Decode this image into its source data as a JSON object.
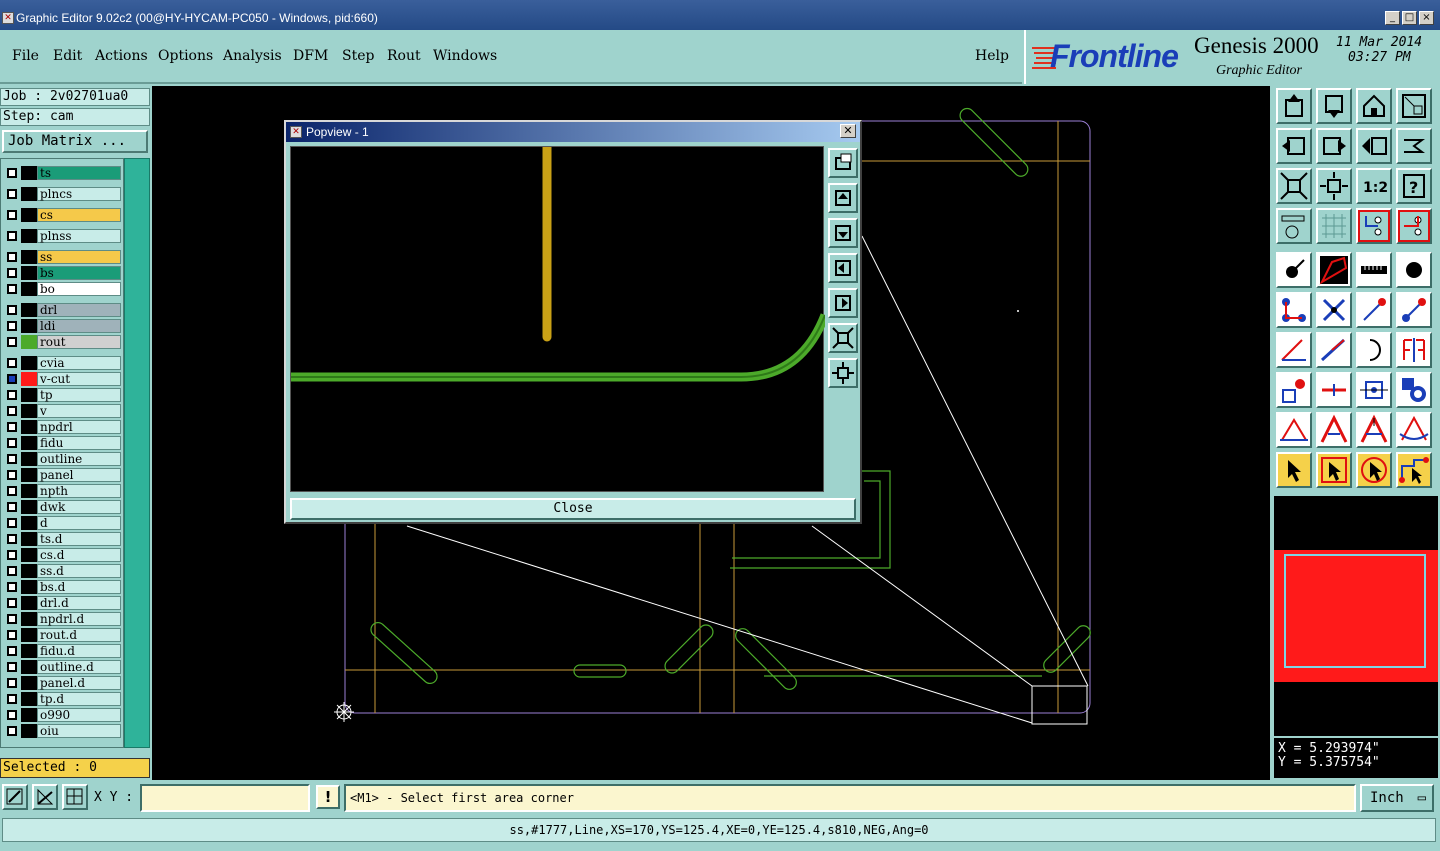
{
  "window": {
    "title": "Graphic Editor 9.02c2 (00@HY-HYCAM-PC050 - Windows, pid:660)",
    "controls": [
      "_",
      "□",
      "×"
    ]
  },
  "menu": [
    "File",
    "Edit",
    "Actions",
    "Options",
    "Analysis",
    "DFM",
    "Step",
    "Rout",
    "Windows"
  ],
  "help": "Help",
  "brand": {
    "logo": "Frontline",
    "product": "Genesis 2000",
    "subtitle": "Graphic Editor",
    "date": "11 Mar 2014",
    "time": "03:27 PM"
  },
  "job": {
    "label": "Job : 2v02701ua0",
    "step": "Step: cam",
    "matrix_button": "Job Matrix ..."
  },
  "layers": [
    {
      "name": "ts",
      "color": "#1a9c78",
      "swatch": "#000000"
    },
    {
      "name": "plncs",
      "color": "#c8ece8",
      "swatch": "#000000"
    },
    {
      "name": "cs",
      "color": "#f5c94a",
      "swatch": "#000000"
    },
    {
      "name": "plnss",
      "color": "#c8ece8",
      "swatch": "#000000"
    },
    {
      "name": "ss",
      "color": "#f5c94a",
      "swatch": "#000000"
    },
    {
      "name": "bs",
      "color": "#1a9c78",
      "swatch": "#000000"
    },
    {
      "name": "bo",
      "color": "#ffffff",
      "swatch": "#000000"
    },
    {
      "name": "drl",
      "color": "#9fb2ba",
      "swatch": "#000000"
    },
    {
      "name": "ldi",
      "color": "#9fb2ba",
      "swatch": "#000000"
    },
    {
      "name": "rout",
      "color": "#d0d0d0",
      "swatch": "#4caa2a"
    },
    {
      "name": "cvia",
      "color": "#c8ece8",
      "swatch": "#000000"
    },
    {
      "name": "v-cut",
      "color": "#c8ece8",
      "swatch": "#ff1a1a"
    },
    {
      "name": "tp",
      "color": "#c8ece8",
      "swatch": "#000000"
    },
    {
      "name": "v",
      "color": "#c8ece8",
      "swatch": "#000000"
    },
    {
      "name": "npdrl",
      "color": "#c8ece8",
      "swatch": "#000000"
    },
    {
      "name": "fidu",
      "color": "#c8ece8",
      "swatch": "#000000"
    },
    {
      "name": "outline",
      "color": "#c8ece8",
      "swatch": "#000000"
    },
    {
      "name": "panel",
      "color": "#c8ece8",
      "swatch": "#000000"
    },
    {
      "name": "npth",
      "color": "#c8ece8",
      "swatch": "#000000"
    },
    {
      "name": "dwk",
      "color": "#c8ece8",
      "swatch": "#000000"
    },
    {
      "name": "d",
      "color": "#c8ece8",
      "swatch": "#000000"
    },
    {
      "name": "ts.d",
      "color": "#c8ece8",
      "swatch": "#000000"
    },
    {
      "name": "cs.d",
      "color": "#c8ece8",
      "swatch": "#000000"
    },
    {
      "name": "ss.d",
      "color": "#c8ece8",
      "swatch": "#000000"
    },
    {
      "name": "bs.d",
      "color": "#c8ece8",
      "swatch": "#000000"
    },
    {
      "name": "drl.d",
      "color": "#c8ece8",
      "swatch": "#000000"
    },
    {
      "name": "npdrl.d",
      "color": "#c8ece8",
      "swatch": "#000000"
    },
    {
      "name": "rout.d",
      "color": "#c8ece8",
      "swatch": "#000000"
    },
    {
      "name": "fidu.d",
      "color": "#c8ece8",
      "swatch": "#000000"
    },
    {
      "name": "outline.d",
      "color": "#c8ece8",
      "swatch": "#000000"
    },
    {
      "name": "panel.d",
      "color": "#c8ece8",
      "swatch": "#000000"
    },
    {
      "name": "tp.d",
      "color": "#c8ece8",
      "swatch": "#000000"
    },
    {
      "name": "o990",
      "color": "#c8ece8",
      "swatch": "#000000"
    },
    {
      "name": "oiu",
      "color": "#c8ece8",
      "swatch": "#000000"
    }
  ],
  "selected": "Selected : 0",
  "popview": {
    "title": "Popview - 1",
    "close_label": "Close"
  },
  "coords": {
    "x": "X = 5.293974\"",
    "y": "Y = 5.375754\""
  },
  "bottom": {
    "xy_label": "X Y :",
    "xy_value": "",
    "exclaim": "!",
    "prompt": "<M1> - Select first area corner",
    "units": "Inch"
  },
  "status": "ss,#1777,Line,XS=170,YS=125.4,XE=0,YE=125.4,s810,NEG,Ang=0",
  "colors": {
    "bg": "#9fd3cd",
    "canvas": "#000000",
    "rout": "#4caa2a",
    "ss_layer": "#c9a116",
    "panel_outline": "#c79a3a",
    "vcut": "#ff1a1a"
  }
}
